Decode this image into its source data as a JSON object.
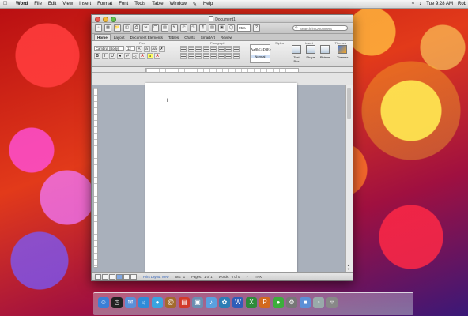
{
  "menubar": {
    "apple_glyph": "",
    "items": [
      "Word",
      "File",
      "Edit",
      "View",
      "Insert",
      "Format",
      "Font",
      "Tools",
      "Table",
      "Window",
      "Help"
    ],
    "clock": "Tue 9:28 AM",
    "user": "Rob"
  },
  "window": {
    "title": "Document1",
    "toolbar": {
      "zoom": "95%",
      "search_placeholder": "Search in Document"
    },
    "ribbon_tabs": [
      "Home",
      "Layout",
      "Document Elements",
      "Tables",
      "Charts",
      "SmartArt",
      "Review"
    ],
    "active_tab": "Home",
    "ribbon": {
      "font_group_label": "Font",
      "font_name": "Cambria (Body)",
      "font_size": "12",
      "paragraph_group_label": "Paragraph",
      "styles_group_label": "Styles",
      "style_sample": "AaBbCcDdEe",
      "style_name": "Normal",
      "insert_group_label": "Insert",
      "insert_items": [
        "Text Box",
        "Shape",
        "Picture"
      ],
      "themes_group_label": "Themes",
      "themes_item": "Themes"
    },
    "page": {
      "cursor": "I"
    },
    "statusbar": {
      "view": "Print Layout View",
      "sec_label": "Sec",
      "sec_value": "1",
      "pages_label": "Pages:",
      "pages_value": "1 of 1",
      "words_label": "Words:",
      "words_value": "0 of 0",
      "zoom_readout": "TRK"
    }
  },
  "dock": {
    "icons": [
      "finder-icon",
      "dashboard-icon",
      "mail-icon",
      "safari-icon",
      "ichat-icon",
      "address-book-icon",
      "ical-icon",
      "preview-icon",
      "itunes-icon",
      "iphoto-icon",
      "word-icon",
      "excel-icon",
      "powerpoint-icon",
      "messenger-icon",
      "system-preferences-icon",
      "folder-icon",
      "documents-icon",
      "trash-icon"
    ]
  }
}
